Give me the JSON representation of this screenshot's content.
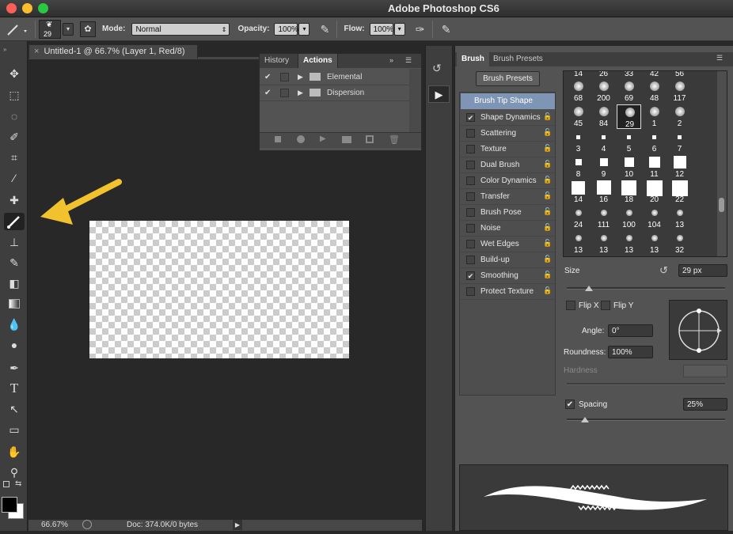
{
  "app": {
    "title": "Adobe Photoshop CS6"
  },
  "options_bar": {
    "brush_size": "29",
    "mode_label": "Mode:",
    "mode_value": "Normal",
    "opacity_label": "Opacity:",
    "opacity_value": "100%",
    "flow_label": "Flow:",
    "flow_value": "100%"
  },
  "document": {
    "tab_title": "Untitled-1 @ 66.7% (Layer 1, Red/8)",
    "zoom": "66.67%",
    "doc_info": "Doc: 374.0K/0 bytes"
  },
  "actions_panel": {
    "tabs": [
      "History",
      "Actions"
    ],
    "items": [
      "Elemental",
      "Dispersion"
    ]
  },
  "brush_panel": {
    "tabs": [
      "Brush",
      "Brush Presets"
    ],
    "presets_button": "Brush Presets",
    "tip_shape_label": "Brush Tip Shape",
    "categories": [
      {
        "label": "Shape Dynamics",
        "checked": true
      },
      {
        "label": "Scattering",
        "checked": false
      },
      {
        "label": "Texture",
        "checked": false
      },
      {
        "label": "Dual Brush",
        "checked": false
      },
      {
        "label": "Color Dynamics",
        "checked": false
      },
      {
        "label": "Transfer",
        "checked": false
      },
      {
        "label": "Brush Pose",
        "checked": false
      },
      {
        "label": "Noise",
        "checked": false
      },
      {
        "label": "Wet Edges",
        "checked": false
      },
      {
        "label": "Build-up",
        "checked": false
      },
      {
        "label": "Smoothing",
        "checked": true
      },
      {
        "label": "Protect Texture",
        "checked": false
      }
    ],
    "tip_rows": [
      [
        "14",
        "26",
        "33",
        "42",
        "56"
      ],
      [
        "68",
        "200",
        "69",
        "48",
        "117"
      ],
      [
        "45",
        "84",
        "29",
        "1",
        "2"
      ],
      [
        "3",
        "4",
        "5",
        "6",
        "7"
      ],
      [
        "8",
        "9",
        "10",
        "11",
        "12"
      ],
      [
        "14",
        "16",
        "18",
        "20",
        "22"
      ],
      [
        "24",
        "111",
        "100",
        "104",
        "13"
      ],
      [
        "13",
        "13",
        "13",
        "13",
        "32"
      ]
    ],
    "size_label": "Size",
    "size_value": "29 px",
    "flip_x": "Flip X",
    "flip_y": "Flip Y",
    "angle_label": "Angle:",
    "angle_value": "0°",
    "roundness_label": "Roundness:",
    "roundness_value": "100%",
    "hardness_label": "Hardness",
    "spacing_label": "Spacing",
    "spacing_value": "25%",
    "spacing_checked": true
  },
  "tools": [
    "move-tool",
    "marquee-tool",
    "lasso-tool",
    "quick-select-tool",
    "crop-tool",
    "eyedropper-tool",
    "healing-brush-tool",
    "brush-tool",
    "clone-stamp-tool",
    "history-brush-tool",
    "eraser-tool",
    "gradient-tool",
    "blur-tool",
    "dodge-tool",
    "pen-tool",
    "type-tool",
    "path-select-tool",
    "rectangle-tool",
    "hand-tool",
    "zoom-tool"
  ],
  "colors": {
    "accent_arrow": "#f2c12e",
    "panel_bg": "#535353",
    "workspace_bg": "#282828"
  }
}
